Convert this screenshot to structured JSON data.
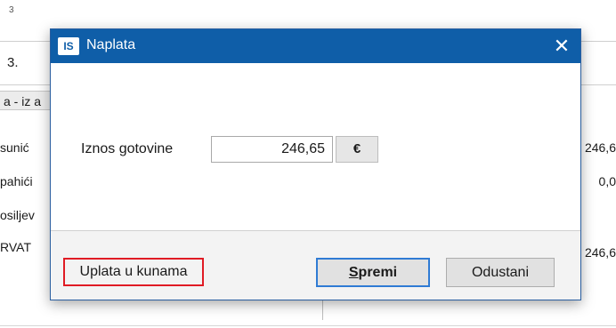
{
  "background": {
    "top_marker": "3",
    "order_number": "3.",
    "column_header": "a - iz a",
    "rows": [
      {
        "name": "sunić",
        "amount": "246,6"
      },
      {
        "name": "pahići",
        "amount": "0,0"
      },
      {
        "name": "osiljev",
        "amount": ""
      },
      {
        "name": "RVAT",
        "amount": "246,6"
      }
    ]
  },
  "dialog": {
    "app_icon": "IS",
    "title": "Naplata",
    "close_glyph": "✕",
    "amount_label": "Iznos gotovine",
    "amount_value": "246,65",
    "currency_label": "€",
    "kune_button": "Uplata u kunama",
    "save_button_mnemonic": "S",
    "save_button_rest": "premi",
    "cancel_button": "Odustani"
  },
  "colors": {
    "titlebar": "#0f5ea8",
    "highlight": "#e01b24",
    "default_button_border": "#2f7bd4"
  }
}
